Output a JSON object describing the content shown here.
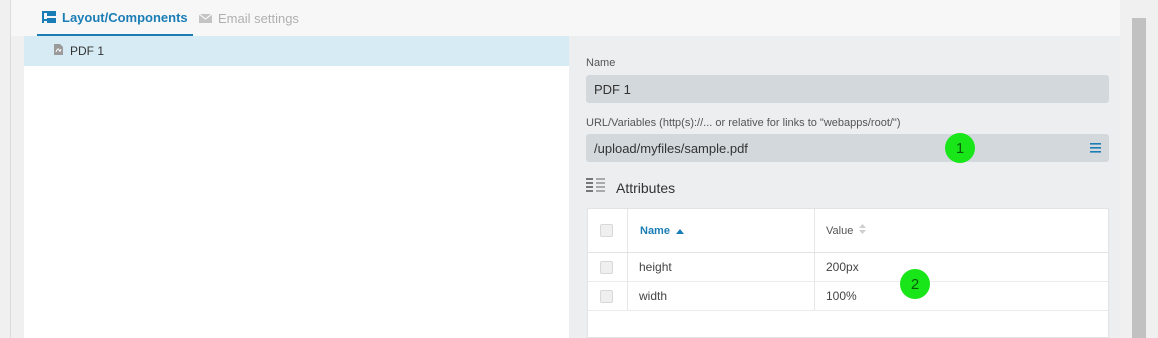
{
  "tabs": [
    {
      "label": "Layout/Components",
      "icon": "tree-icon",
      "active": true
    },
    {
      "label": "Email settings",
      "icon": "envelope-icon",
      "active": false
    }
  ],
  "tree": {
    "items": [
      {
        "label": "PDF 1",
        "icon": "pdf-file-icon",
        "selected": true
      }
    ]
  },
  "form": {
    "name_label": "Name",
    "name_value": "PDF 1",
    "url_label": "URL/Variables (http(s)://... or relative for links to \"webapps/root/\")",
    "url_value": "/upload/myfiles/sample.pdf",
    "url_menu_icon": "menu-icon"
  },
  "attributes": {
    "title": "Attributes",
    "title_icon": "list-columns-icon",
    "columns": {
      "name": "Name",
      "value": "Value"
    },
    "sort": {
      "name": "asc",
      "value": "none"
    },
    "rows": [
      {
        "name": "height",
        "value": "200px"
      },
      {
        "name": "width",
        "value": "100%"
      }
    ]
  },
  "markers": [
    "1",
    "2"
  ],
  "colors": {
    "accent": "#1a7db6",
    "selected_row": "#d6ebf3",
    "input_bg": "#d3d8dd",
    "marker": "#19e619"
  }
}
